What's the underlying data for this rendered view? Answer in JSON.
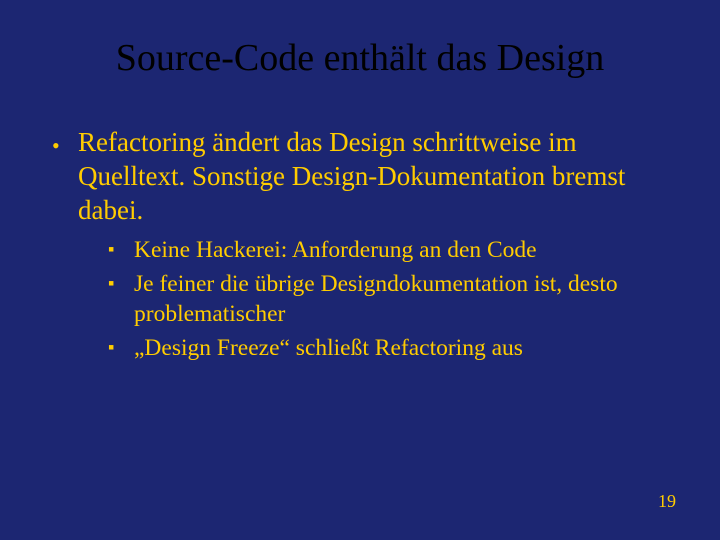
{
  "title": "Source-Code enthält das Design",
  "bullets": [
    {
      "text": "Refactoring ändert das Design schrittweise im Quelltext. Sonstige Design-Dokumentation bremst dabei.",
      "sub": [
        "Keine Hackerei: Anforderung an den Code",
        "Je feiner die übrige Designdokumentation ist, desto problematischer",
        "„Design Freeze“ schließt Refactoring aus"
      ]
    }
  ],
  "page_number": "19"
}
